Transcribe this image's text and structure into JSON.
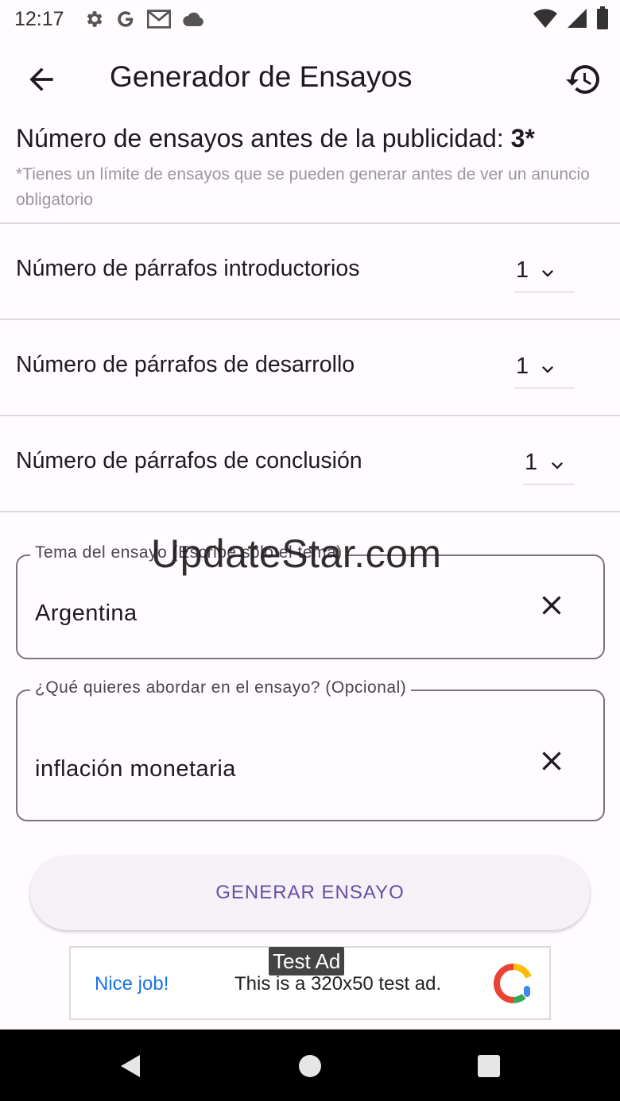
{
  "status_bar": {
    "time": "12:17",
    "icons_left": [
      "gear-icon",
      "google-icon",
      "gmail-icon",
      "cloud-icon"
    ],
    "icons_right": [
      "wifi-icon",
      "signal-icon",
      "battery-icon"
    ]
  },
  "app_bar": {
    "title": "Generador de Ensayos",
    "back_icon": "arrow-back-icon",
    "history_icon": "history-icon"
  },
  "counter": {
    "label": "Número de ensayos antes de la publicidad: ",
    "value": "3*",
    "note": "*Tienes un límite de ensayos que se pueden generar antes de ver un anuncio obligatorio"
  },
  "settings": [
    {
      "label": "Número de párrafos introductorios",
      "value": "1"
    },
    {
      "label": "Número de párrafos de desarrollo",
      "value": "1"
    },
    {
      "label": "Número de párrafos de conclusión",
      "value": "1"
    }
  ],
  "topic_field": {
    "label": "Tema del ensayo (Escribe sólo el tema)",
    "value": "Argentina"
  },
  "focus_field": {
    "label": "¿Qué quieres abordar en el ensayo? (Opcional)",
    "value": "inflación monetaria"
  },
  "generate_button": {
    "label": "GENERAR ENSAYO"
  },
  "ad": {
    "tag": "Test Ad",
    "nice": "Nice job!",
    "text": "This is a 320x50 test ad."
  },
  "watermark": "UpdateStar.com",
  "colors": {
    "accent": "#6750a4",
    "background": "#fffbfe",
    "ad_link": "#1a73e8"
  }
}
